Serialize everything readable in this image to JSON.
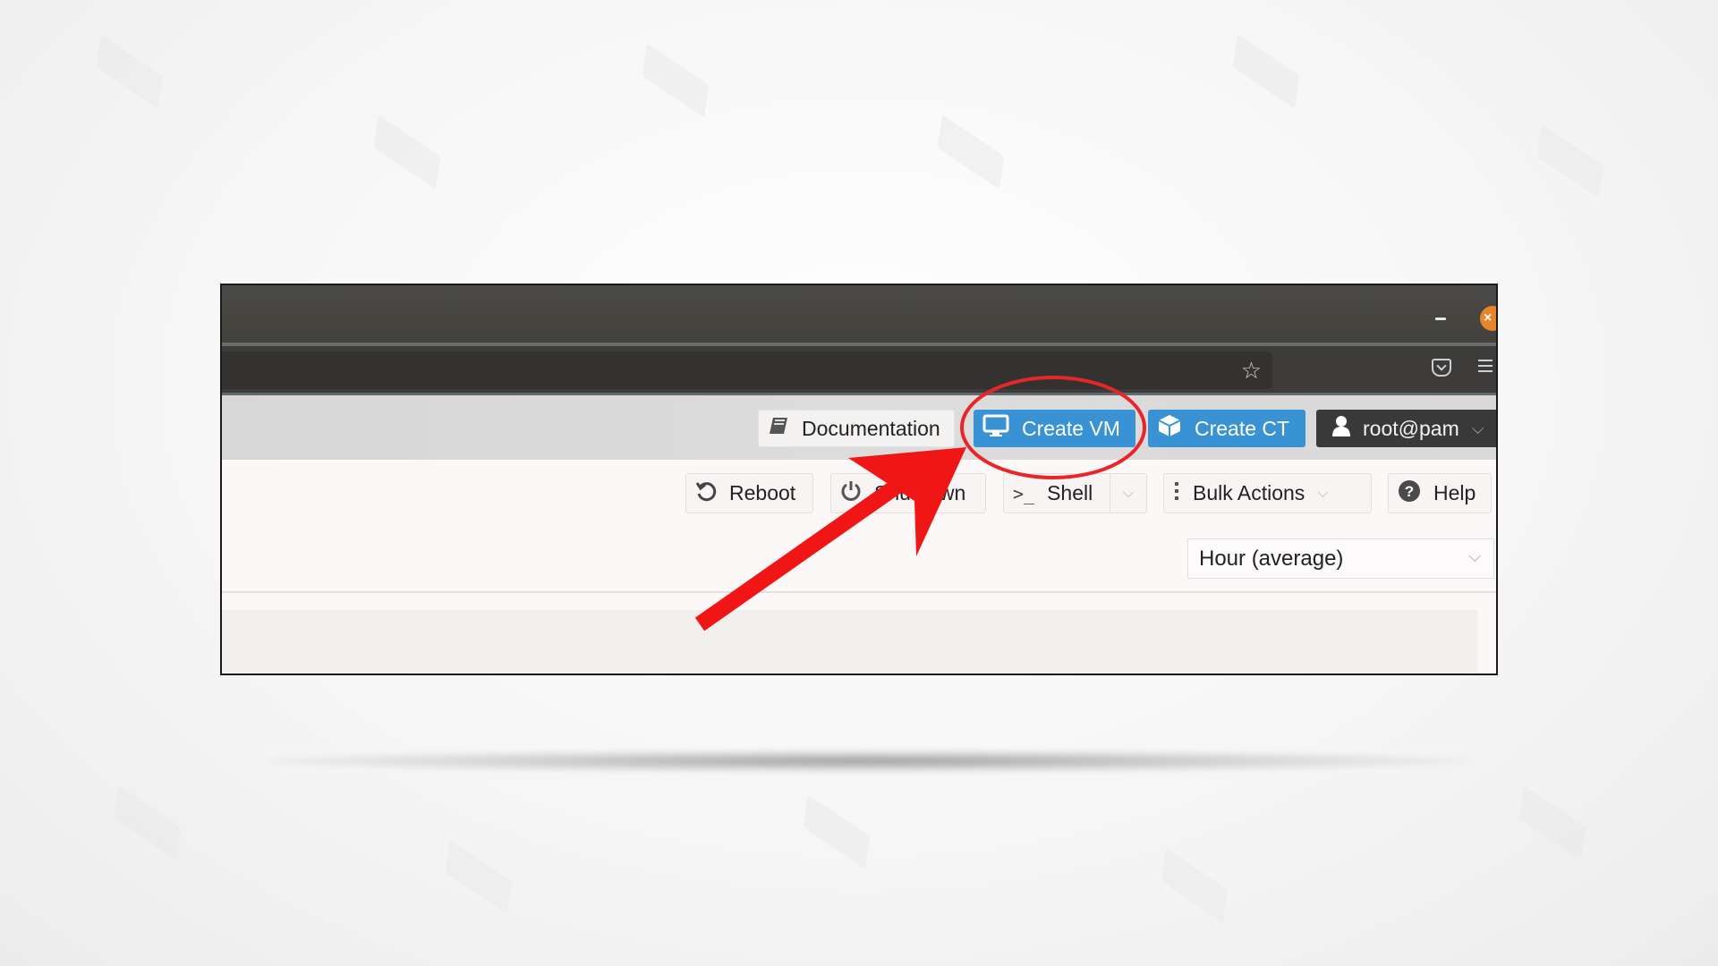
{
  "window": {
    "title_controls": {
      "minimize": "–",
      "close": "×"
    },
    "browser_icons": [
      "bookmark-star-icon",
      "pocket-icon",
      "hamburger-menu-icon"
    ]
  },
  "header": {
    "documentation_label": "Documentation",
    "create_vm_label": "Create VM",
    "create_ct_label": "Create CT",
    "user_label": "root@pam",
    "accent_color": "#3892d3"
  },
  "toolbar": {
    "reboot_label": "Reboot",
    "shutdown_label": "Shutdown",
    "shell_label": "Shell",
    "bulk_actions_label": "Bulk Actions",
    "help_label": "Help"
  },
  "timeframe": {
    "selected": "Hour (average)"
  },
  "annotation": {
    "highlight_target": "Create VM",
    "highlight_color": "#e8262a",
    "arrow_color": "#f01616"
  }
}
